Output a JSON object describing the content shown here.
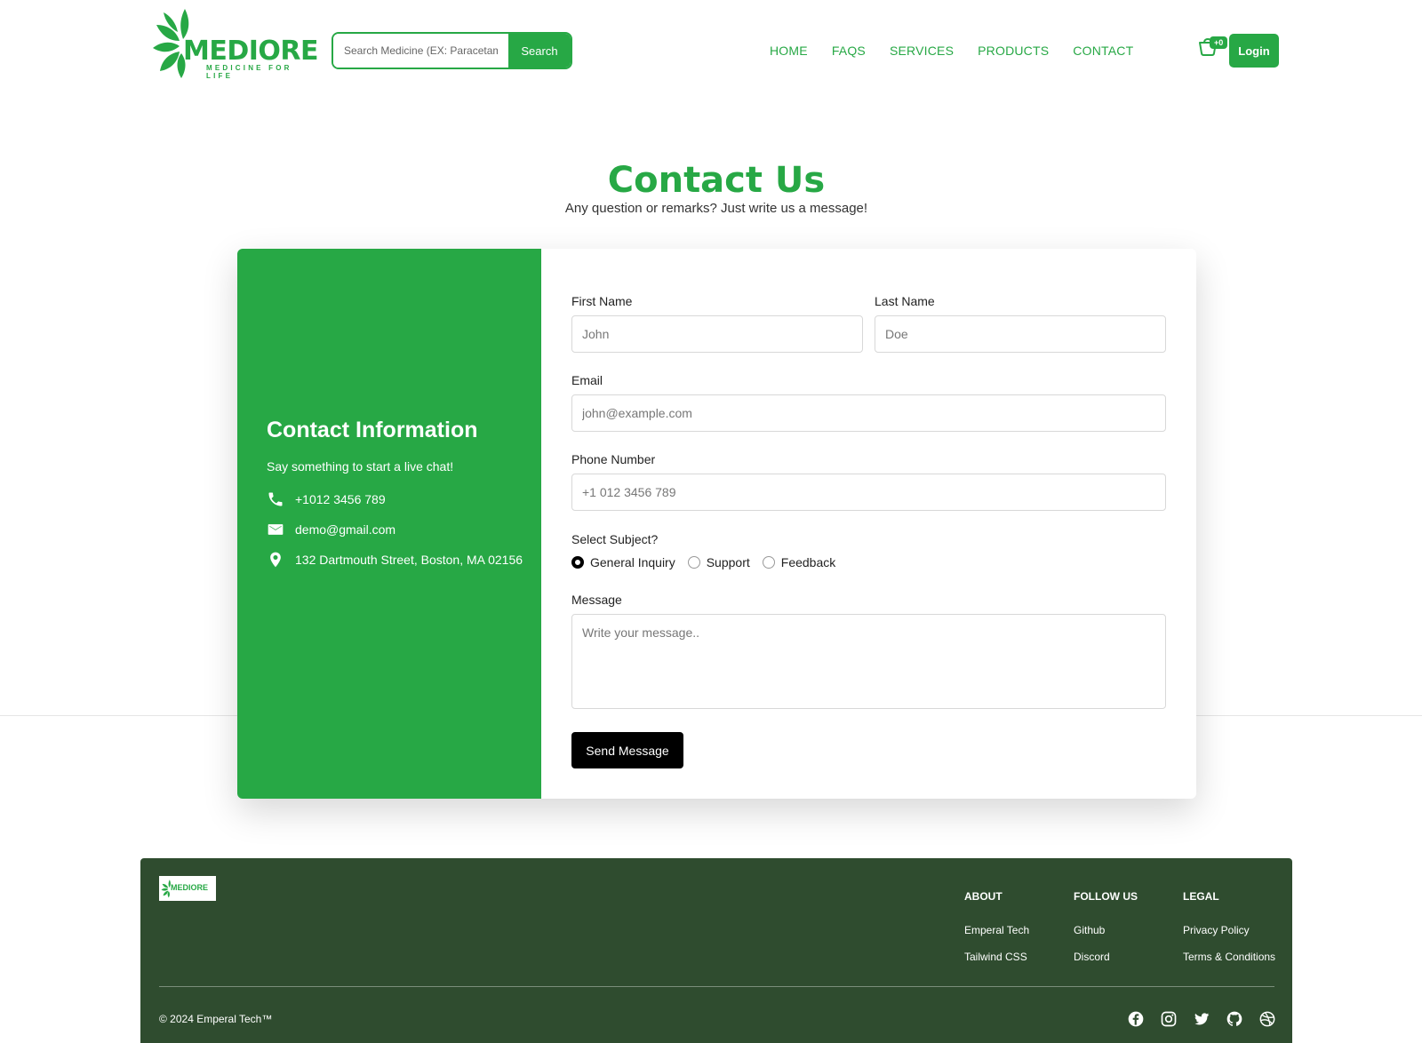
{
  "header": {
    "logo_word": "MEDIORE",
    "logo_tagline": "MEDICINE FOR LIFE",
    "search_placeholder": "Search Medicine (EX: Paracetamol)",
    "search_button": "Search",
    "nav": [
      "HOME",
      "FAQS",
      "SERVICES",
      "PRODUCTS",
      "CONTACT"
    ],
    "cart_count": "+0",
    "login_label": "Login"
  },
  "hero": {
    "title": "Contact Us",
    "subtitle": "Any question or remarks? Just write us a message!"
  },
  "contact_info": {
    "title": "Contact Information",
    "subtitle": "Say something to start a live chat!",
    "phone": "+1012 3456 789",
    "email": "demo@gmail.com",
    "address": "132 Dartmouth Street, Boston, MA 02156"
  },
  "form": {
    "first_name_label": "First Name",
    "first_name_placeholder": "John",
    "last_name_label": "Last Name",
    "last_name_placeholder": "Doe",
    "email_label": "Email",
    "email_placeholder": "john@example.com",
    "phone_label": "Phone Number",
    "phone_placeholder": "+1 012 3456 789",
    "subject_label": "Select Subject?",
    "subjects": [
      "General Inquiry",
      "Support",
      "Feedback"
    ],
    "selected_subject": "General Inquiry",
    "message_label": "Message",
    "message_placeholder": "Write your message..",
    "send_label": "Send Message"
  },
  "footer": {
    "logo_word": "MEDIORE",
    "columns": [
      {
        "title": "ABOUT",
        "links": [
          "Emperal Tech",
          "Tailwind CSS"
        ]
      },
      {
        "title": "FOLLOW US",
        "links": [
          "Github",
          "Discord"
        ]
      },
      {
        "title": "LEGAL",
        "links": [
          "Privacy Policy",
          "Terms & Conditions"
        ]
      }
    ],
    "copyright": "© 2024 Emperal Tech™",
    "social_icons": [
      "facebook-icon",
      "instagram-icon",
      "twitter-icon",
      "github-icon",
      "dribbble-icon"
    ]
  },
  "colors": {
    "brand_green": "#27a845",
    "footer_bg": "#2f4c2f",
    "button_dark": "#000000"
  }
}
